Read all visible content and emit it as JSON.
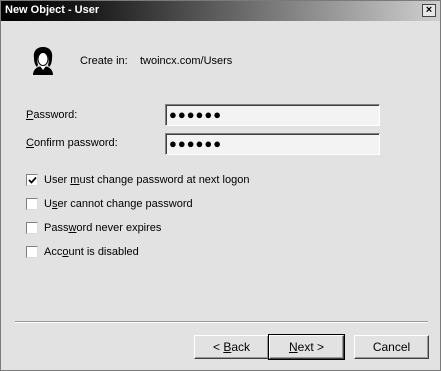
{
  "window": {
    "title": "New Object - User",
    "close_glyph": "×"
  },
  "header": {
    "create_in_label": "Create in:",
    "create_in_value": "twoincx.com/Users",
    "icon": "user-icon"
  },
  "fields": {
    "password": {
      "label": "Password:",
      "value": "●●●●●●"
    },
    "confirm": {
      "label": "Confirm password:",
      "value": "●●●●●●"
    }
  },
  "options": [
    {
      "label": "User must change password at next logon",
      "checked": true
    },
    {
      "label": "User cannot change password",
      "checked": false
    },
    {
      "label": "Password never expires",
      "checked": false
    },
    {
      "label": "Account is disabled",
      "checked": false
    }
  ],
  "buttons": {
    "back": "< Back",
    "next": "Next >",
    "cancel": "Cancel"
  }
}
